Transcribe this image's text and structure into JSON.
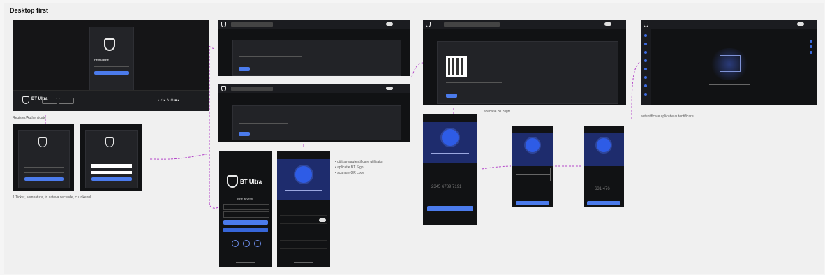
{
  "board": {
    "title": "Desktop first"
  },
  "notes": {
    "register_auth": "Register/Authenticate",
    "eticket": "1 Ticket, semnatura, in cateva secunde, cu tokenul",
    "bt_sign_note": "aplicatie BT Sign",
    "autentificare_note": "autentificare aplicatie autentificare"
  },
  "bullets": {
    "mobile": [
      "utilizare/autentificare utilizator",
      "aplicatie BT Sign",
      "scanare QR code"
    ]
  },
  "desktop": {
    "login_title": "Pentru Bine",
    "store_badges": [
      "App Store",
      "Google Play"
    ]
  },
  "mobile": {
    "brand": "BT Ultra",
    "welcome": "Bine ai venit",
    "big_code_1": "2345 6789 7191",
    "big_code_2": "631 476"
  },
  "icons": [
    "shield-logo-icon",
    "toggle-icon",
    "menu-icon",
    "qr-code-icon",
    "fingerprint-icon"
  ]
}
